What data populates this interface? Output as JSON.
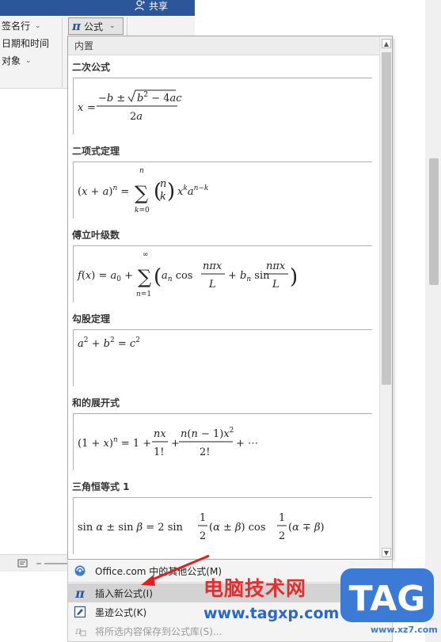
{
  "ribbon": {
    "share_label": "共享",
    "left_items": [
      {
        "label": "签名行"
      },
      {
        "label": "日期和时间"
      },
      {
        "label": "对象"
      }
    ],
    "formula_button": {
      "label": "公式"
    }
  },
  "gallery": {
    "header": "内置",
    "entries": [
      {
        "title": "二次公式"
      },
      {
        "title": "二项式定理"
      },
      {
        "title": "傅立叶级数"
      },
      {
        "title": "勾股定理"
      },
      {
        "title": "和的展开式"
      },
      {
        "title": "三角恒等式 1"
      }
    ]
  },
  "menu": {
    "items": [
      {
        "label": "Office.com 中的其他公式(M)",
        "icon": "office-icon"
      },
      {
        "label": "插入新公式(I)",
        "icon": "pi-icon"
      },
      {
        "label": "墨迹公式(K)",
        "icon": "ink-icon"
      },
      {
        "label": "将所选内容保存到公式库(S)...",
        "icon": "save-icon"
      }
    ]
  },
  "watermark": {
    "site_name": "电脑技术网",
    "url": "www.tagxp.com",
    "logo": "TAG",
    "small": "www.xz7.com"
  },
  "colors": {
    "accent": "#2b579a",
    "watermark_red": "#e12f2f",
    "watermark_blue": "#2b67c8"
  }
}
